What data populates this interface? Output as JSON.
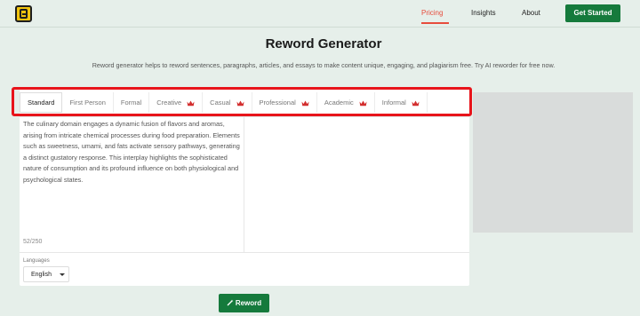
{
  "nav": {
    "links": [
      {
        "label": "Pricing",
        "active": true
      },
      {
        "label": "Insights",
        "active": false
      },
      {
        "label": "About",
        "active": false
      }
    ],
    "cta_label": "Get Started"
  },
  "hero": {
    "title": "Reword Generator",
    "subtitle": "Reword generator helps to reword sentences, paragraphs, articles, and essays to make content unique, engaging, and plagiarism free. Try AI reworder for free now."
  },
  "modes": [
    {
      "label": "Standard",
      "premium": false,
      "active": true
    },
    {
      "label": "First Person",
      "premium": false,
      "active": false
    },
    {
      "label": "Formal",
      "premium": false,
      "active": false
    },
    {
      "label": "Creative",
      "premium": true,
      "active": false
    },
    {
      "label": "Casual",
      "premium": true,
      "active": false
    },
    {
      "label": "Professional",
      "premium": true,
      "active": false
    },
    {
      "label": "Academic",
      "premium": true,
      "active": false
    },
    {
      "label": "Informal",
      "premium": true,
      "active": false
    }
  ],
  "editor": {
    "input_text": "The culinary domain engages a dynamic fusion of flavors and aromas, arising from intricate chemical processes during food preparation. Elements such as sweetness, umami, and fats activate sensory pathways, generating a distinct gustatory response. This interplay highlights the sophisticated nature of consumption and its profound influence on both physiological and psychological states.",
    "char_count": "52/250",
    "languages_label": "Languages",
    "language_value": "English"
  },
  "actions": {
    "reword_label": "Reword"
  },
  "colors": {
    "brand_green": "#157a3c",
    "accent_red": "#e74c3c",
    "highlight_red": "#e8141b",
    "crown_red": "#d32f2f",
    "background": "#e6efea"
  }
}
